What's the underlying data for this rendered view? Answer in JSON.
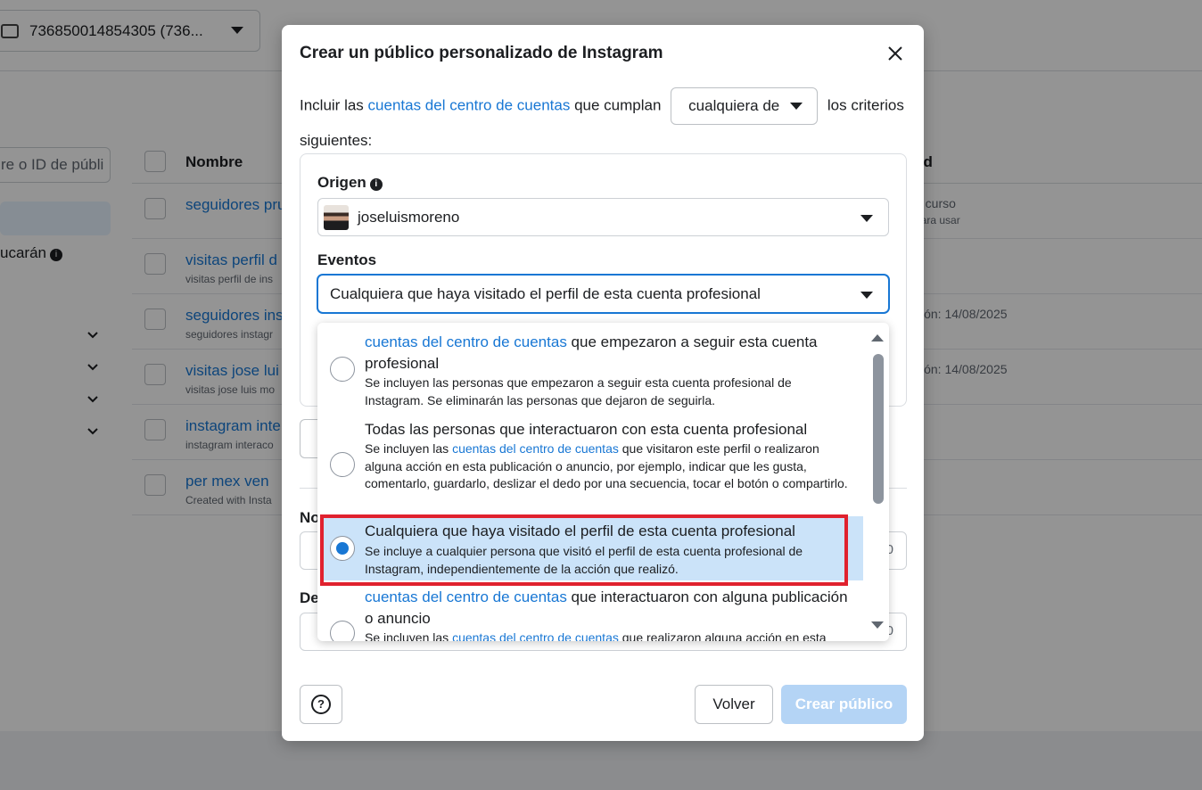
{
  "background": {
    "account_selector": "736850014854305 (736...",
    "search_placeholder": "re o ID de públi",
    "side_text": "ucarán",
    "table_header": {
      "name": "Nombre",
      "right": "ad"
    },
    "rows": [
      {
        "name": "seguidores pru",
        "sub": "",
        "status": "n curso",
        "status_sub": "para usar"
      },
      {
        "name": "visitas perfil d",
        "sub": "visitas perfil de ins",
        "status": "",
        "status_sub": ""
      },
      {
        "name": "seguidores ins",
        "sub": "seguidores instagr",
        "status": "ción: 14/08/2025",
        "status_sub": ""
      },
      {
        "name": "visitas jose lui",
        "sub": "visitas jose luis mo",
        "status": "ción: 14/08/2025",
        "status_sub": ""
      },
      {
        "name": "instagram inte",
        "sub": "instagram interaco",
        "status": "",
        "status_sub": ""
      },
      {
        "name": "per mex ven",
        "sub": "Created with Insta",
        "status": "",
        "status_sub": ""
      }
    ]
  },
  "modal": {
    "title": "Crear un público personalizado de Instagram",
    "intro_before": "Incluir las ",
    "intro_link": "cuentas del centro de cuentas",
    "intro_mid": " que cumplan",
    "match_select": "cualquiera de",
    "intro_after": " los criterios siguientes:",
    "origin_label": "Origen",
    "origin_value": "joseluismoreno",
    "events_label": "Eventos",
    "events_value": "Cualquiera que haya visitado el perfil de esta cuenta profesional",
    "name_label": "No",
    "desc_label": "De",
    "name_count": "0",
    "desc_count": "0",
    "back_button": "Volver",
    "create_button": "Crear público",
    "help_symbol": "?"
  },
  "dropdown": {
    "options": [
      {
        "title_link": "cuentas del centro de cuentas",
        "title_rest": " que empezaron a seguir esta cuenta profesional",
        "desc_before": "Se incluyen las personas que empezaron a seguir esta cuenta profesional de Instagram. Se eliminarán las personas que dejaron de seguirla.",
        "desc_link": "",
        "desc_after": "",
        "selected": false
      },
      {
        "title_link": "",
        "title_rest": "Todas las personas que interactuaron con esta cuenta profesional",
        "desc_before": "Se incluyen las ",
        "desc_link": "cuentas del centro de cuentas",
        "desc_after": " que visitaron este perfil o realizaron alguna acción en esta publicación o anuncio, por ejemplo, indicar que les gusta, comentarlo, guardarlo, deslizar el dedo por una secuencia, tocar el botón o compartirlo.",
        "selected": false
      },
      {
        "title_link": "",
        "title_rest": "Cualquiera que haya visitado el perfil de esta cuenta profesional",
        "desc_before": "Se incluye a cualquier persona que visitó el perfil de esta cuenta profesional de Instagram, independientemente de la acción que realizó.",
        "desc_link": "",
        "desc_after": "",
        "selected": true
      },
      {
        "title_link": "cuentas del centro de cuentas",
        "title_rest": " que interactuaron con alguna publicación o anuncio",
        "desc_before": "Se incluyen las ",
        "desc_link": "cuentas del centro de cuentas",
        "desc_after": " que realizaron alguna acción en esta",
        "selected": false
      }
    ]
  }
}
